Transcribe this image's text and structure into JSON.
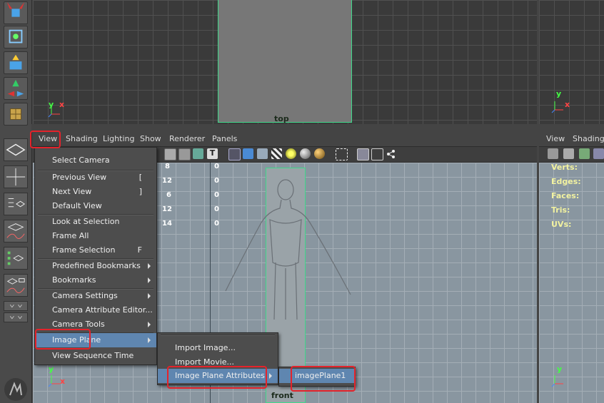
{
  "top_view": {
    "label": "top",
    "axis_y": "y",
    "axis_x": "x"
  },
  "panel_menu": [
    {
      "key": "view",
      "label": "View"
    },
    {
      "key": "shading",
      "label": "Shading"
    },
    {
      "key": "lighting",
      "label": "Lighting"
    },
    {
      "key": "show",
      "label": "Show"
    },
    {
      "key": "renderer",
      "label": "Renderer"
    },
    {
      "key": "panels",
      "label": "Panels"
    }
  ],
  "right_panel_menu": {
    "view": "View",
    "shading": "Shading"
  },
  "right_hud": {
    "verts": "Verts:",
    "edges": "Edges:",
    "faces": "Faces:",
    "tris": "Tris:",
    "uvs": "UVs:"
  },
  "hud_values": [
    {
      "a": "8",
      "b": "0"
    },
    {
      "a": "12",
      "b": "0"
    },
    {
      "a": "6",
      "b": "0"
    },
    {
      "a": "12",
      "b": "0"
    },
    {
      "a": "14",
      "b": "0"
    }
  ],
  "front_view": {
    "label": "front",
    "axis_y": "y",
    "axis_x": "x"
  },
  "view_menu": {
    "items": [
      {
        "label": "Select Camera",
        "shortcut": ""
      },
      {
        "label": "Previous View",
        "shortcut": "["
      },
      {
        "label": "Next View",
        "shortcut": "]"
      },
      {
        "label": "Default View",
        "shortcut": ""
      },
      {
        "label": "Look at Selection",
        "shortcut": ""
      },
      {
        "label": "Frame All",
        "shortcut": ""
      },
      {
        "label": "Frame Selection",
        "shortcut": "F"
      },
      {
        "label": "Predefined Bookmarks",
        "shortcut": ""
      },
      {
        "label": "Bookmarks",
        "shortcut": ""
      },
      {
        "label": "Camera Settings",
        "shortcut": ""
      },
      {
        "label": "Camera Attribute Editor...",
        "shortcut": ""
      },
      {
        "label": "Camera Tools",
        "shortcut": ""
      },
      {
        "label": "Image Plane",
        "shortcut": ""
      },
      {
        "label": "View Sequence Time",
        "shortcut": ""
      }
    ]
  },
  "image_plane_menu": {
    "items": [
      {
        "label": "Import Image..."
      },
      {
        "label": "Import Movie..."
      },
      {
        "label": "Image Plane Attributes"
      }
    ]
  },
  "attributes_menu": {
    "items": [
      {
        "label": "imagePlane1"
      }
    ]
  },
  "colors": {
    "highlight": "#5f86b0",
    "annotation": "#e4232b",
    "hud_label": "#f2f2a0",
    "camera_frame": "#3fd88a"
  }
}
